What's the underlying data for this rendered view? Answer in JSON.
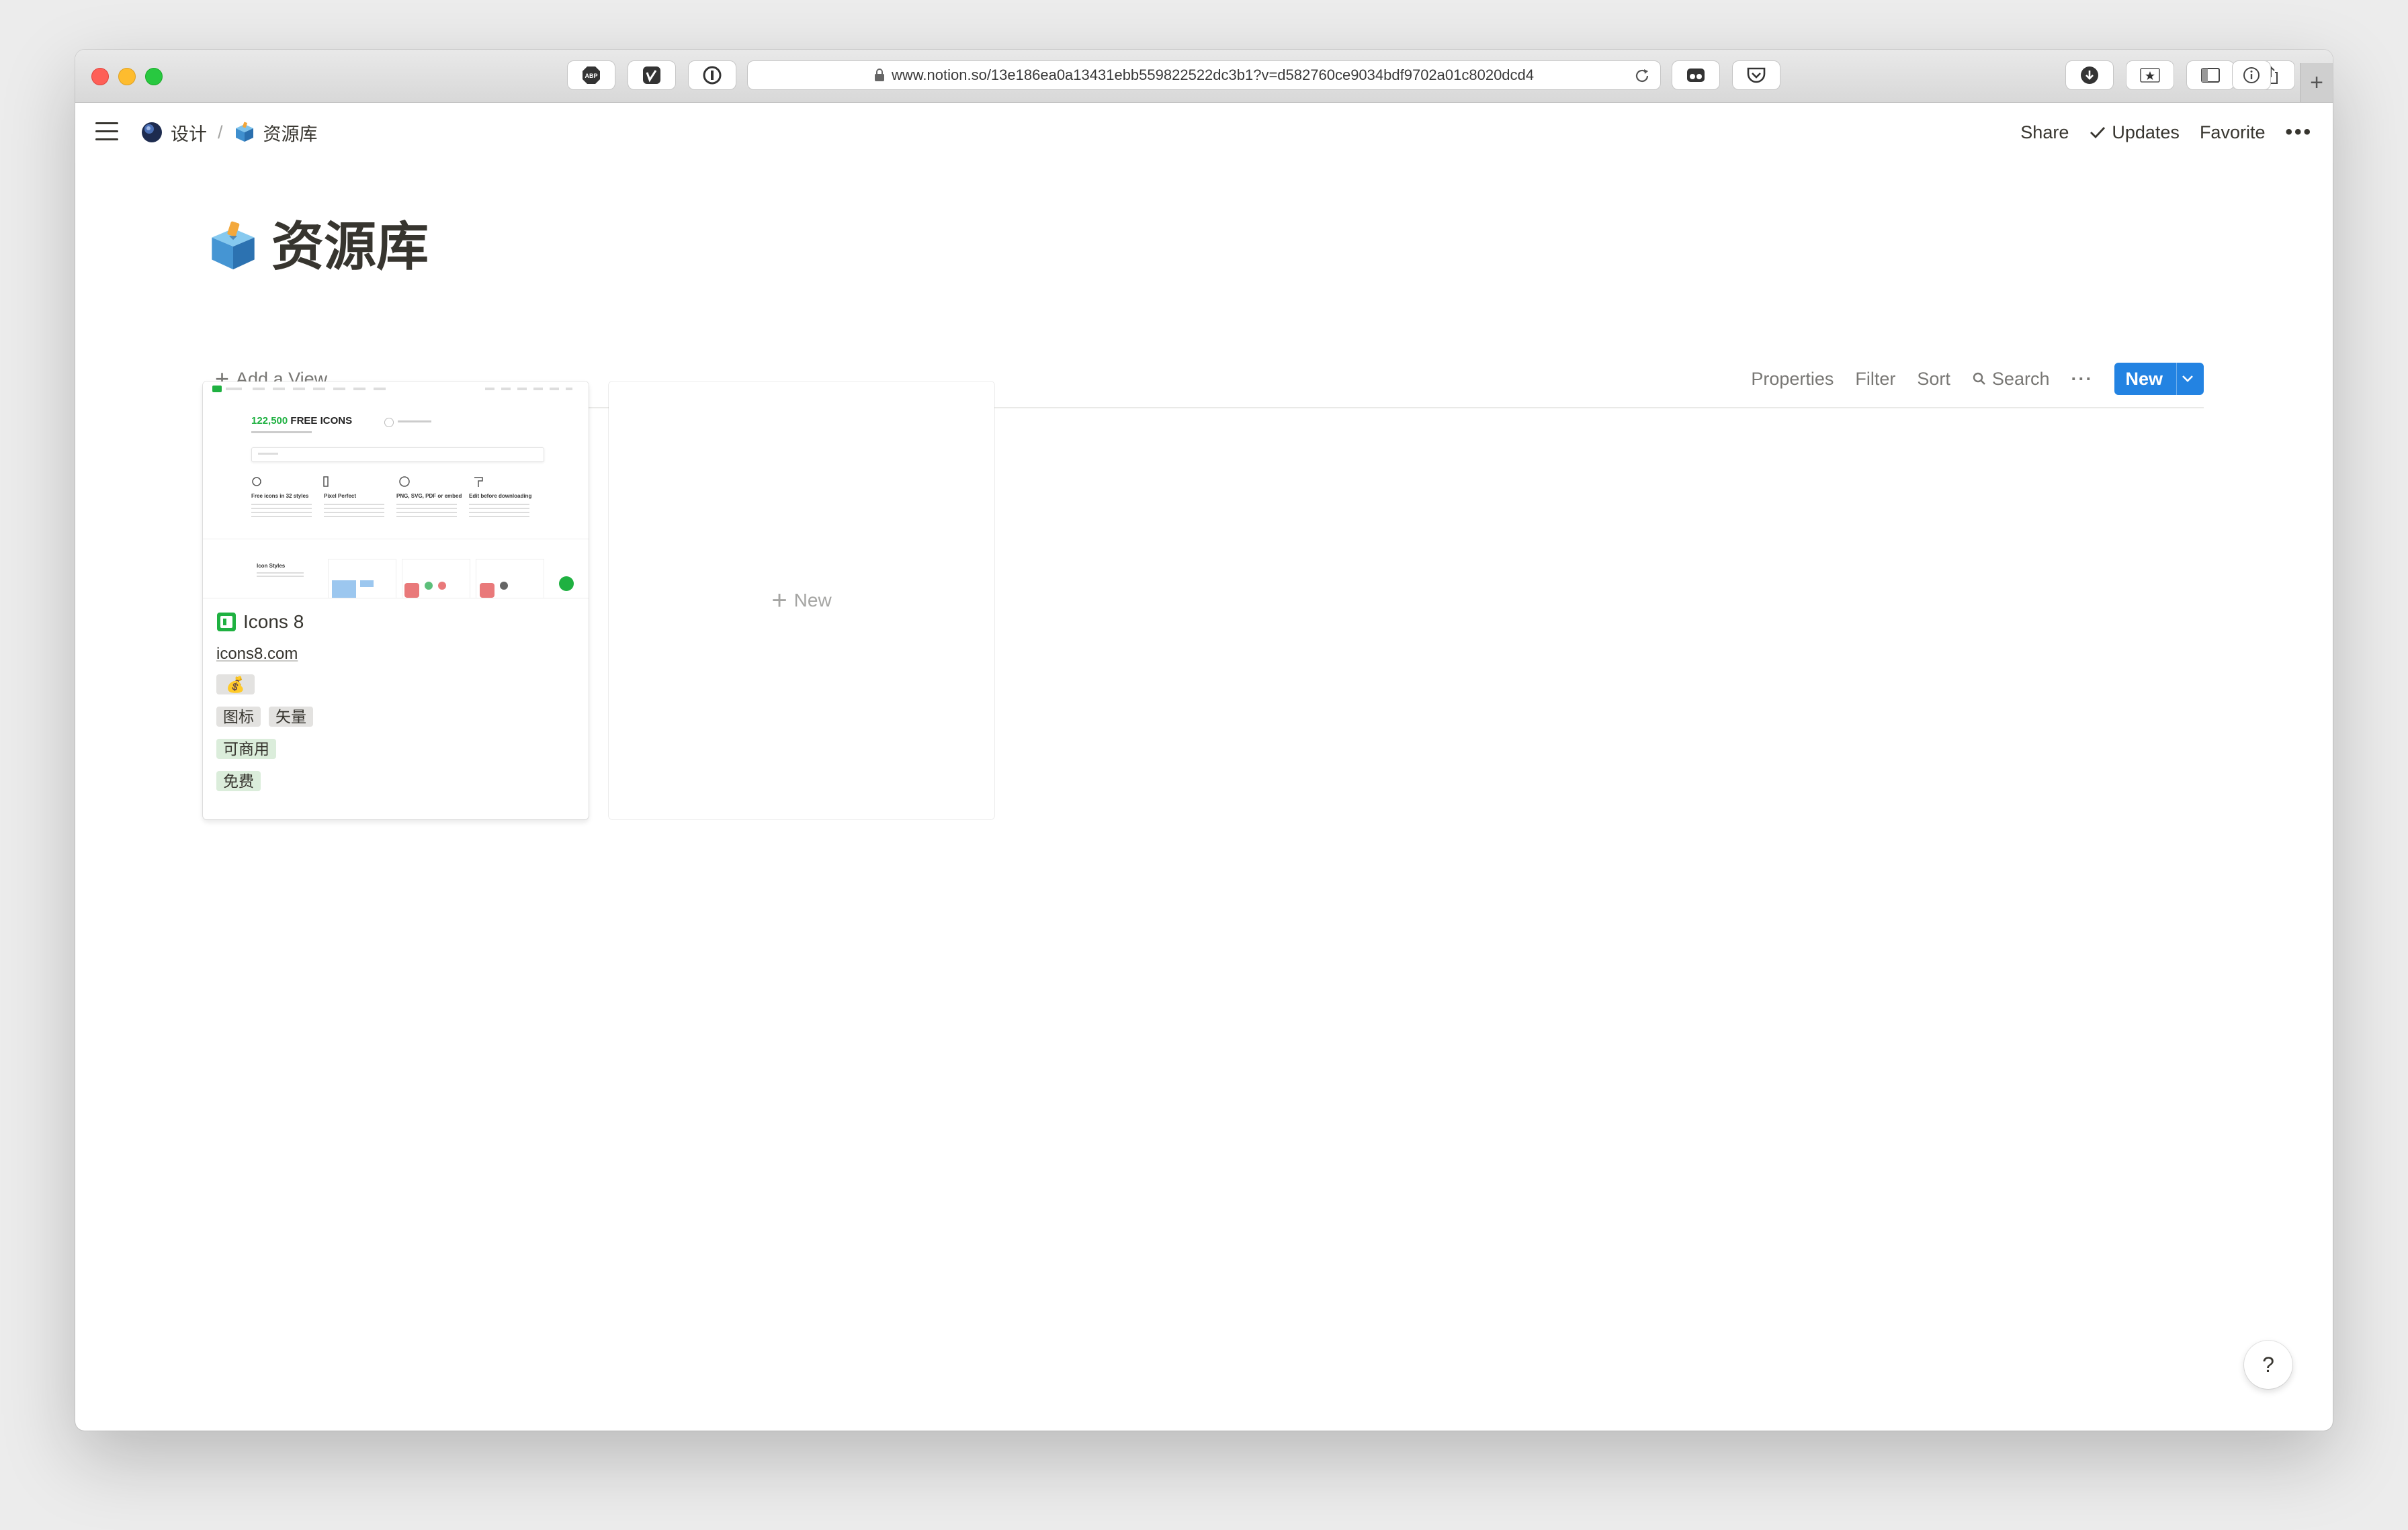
{
  "browser": {
    "url": "www.notion.so/13e186ea0a13431ebb559822522dc3b1?v=d582760ce9034bdf9702a01c8020dcd4",
    "toolbar_left": [
      "abp-icon",
      "vimeo-icon",
      "onepassword-icon"
    ],
    "toolbar_mid": [
      "reading-icon",
      "pocket-icon"
    ],
    "toolbar_right": [
      "download-icon",
      "star-icon",
      "sidebar-icon",
      "share-icon",
      "info-icon"
    ],
    "new_tab_label": "+"
  },
  "topbar": {
    "breadcrumbs": [
      {
        "label": "设计",
        "icon": "globe-icon"
      },
      {
        "label": "资源库",
        "icon": "cube-box-icon"
      }
    ],
    "separator": "/",
    "share_label": "Share",
    "updates_label": "Updates",
    "favorite_label": "Favorite",
    "more_label": "•••"
  },
  "page": {
    "title": "资源库",
    "icon": "cube-box-icon"
  },
  "viewbar": {
    "add_view_label": "Add a View",
    "properties_label": "Properties",
    "filter_label": "Filter",
    "sort_label": "Sort",
    "search_label": "Search",
    "more_label": "···",
    "new_label": "New"
  },
  "cards": [
    {
      "name": "Icons 8",
      "url": "icons8.com",
      "emoji_tag": "💰",
      "tags_gray": [
        "图标",
        "矢量"
      ],
      "tag_commercial": "可商用",
      "tag_free": "免费",
      "cover": {
        "headline_count": "122,500",
        "headline_text": "FREE ICONS",
        "features": [
          "Free icons in 32 styles",
          "Pixel Perfect",
          "PNG, SVG, PDF or embed",
          "Edit before downloading"
        ],
        "section_title": "Icon Styles"
      }
    }
  ],
  "new_card_label": "New",
  "help_label": "?",
  "colors": {
    "accent": "#2383e2",
    "icons8_green": "#1fb141",
    "text": "#37352f",
    "muted": "#787774"
  }
}
